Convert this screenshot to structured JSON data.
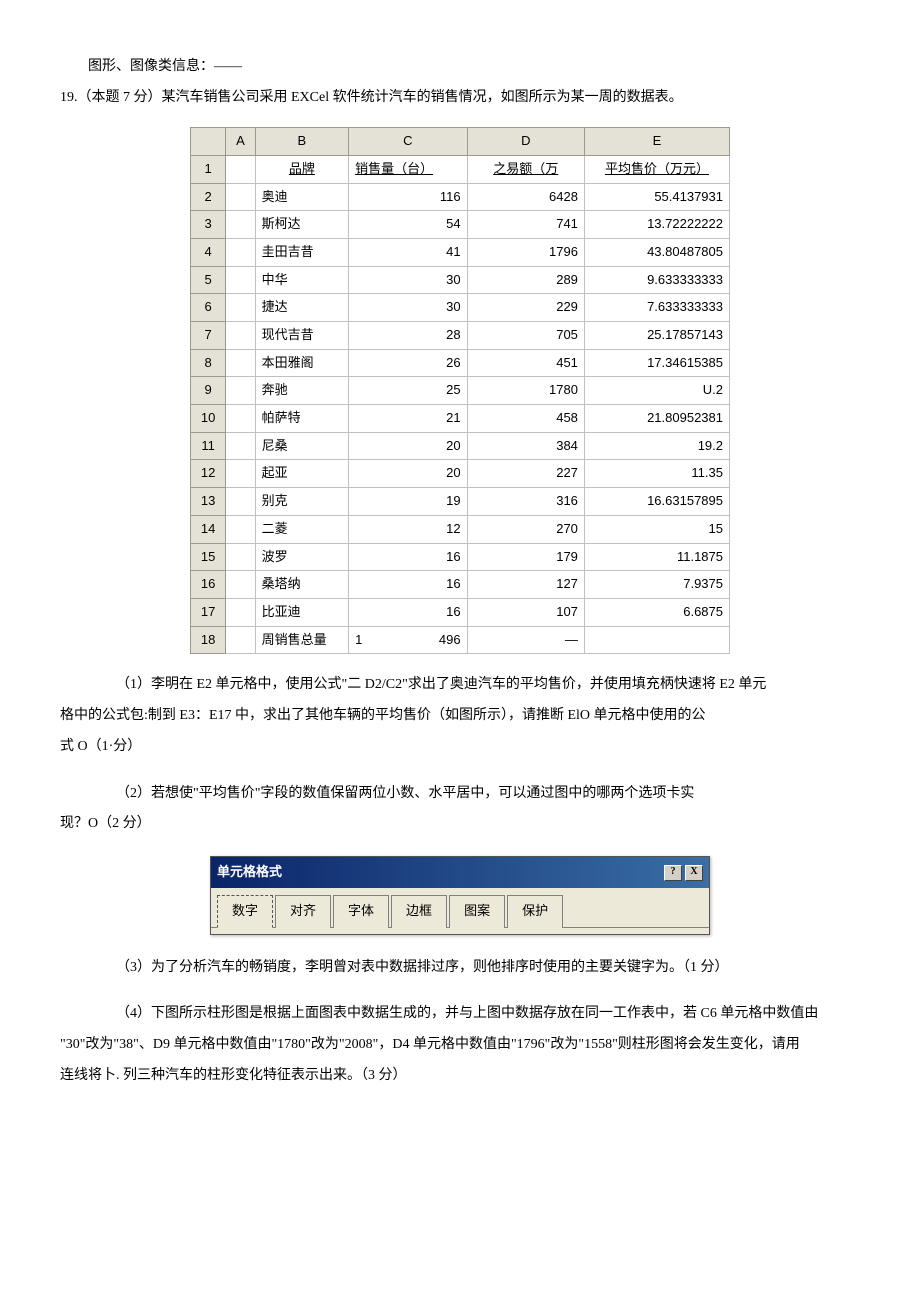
{
  "intro1": "图形、图像类信息：——",
  "intro2": "19.（本题 7 分）某汽车销售公司采用 EXCel 软件统计汽车的销售情况，如图所示为某一周的数据表。",
  "excel": {
    "col_headers": {
      "rownum": "",
      "A": "A",
      "B": "B",
      "C": "C",
      "D": "D",
      "E": "E"
    },
    "header_row": {
      "num": "1",
      "brand": "品牌",
      "sales": "销售量（台）",
      "amount": "之易额（万",
      "avg": "平均售价（万元）"
    },
    "rows": [
      {
        "num": "2",
        "brand": "奥迪",
        "sales": "116",
        "amount": "6428",
        "avg": "55.4137931"
      },
      {
        "num": "3",
        "brand": "斯柯达",
        "sales": "54",
        "amount": "741",
        "avg": "13.72222222"
      },
      {
        "num": "4",
        "brand": "圭田吉昔",
        "sales": "41",
        "amount": "1796",
        "avg": "43.80487805"
      },
      {
        "num": "5",
        "brand": "中华",
        "sales": "30",
        "amount": "289",
        "avg": "9.633333333"
      },
      {
        "num": "6",
        "brand": "捷达",
        "sales": "30",
        "amount": "229",
        "avg": "7.633333333"
      },
      {
        "num": "7",
        "brand": "现代吉昔",
        "sales": "28",
        "amount": "705",
        "avg": "25.17857143"
      },
      {
        "num": "8",
        "brand": "本田雅阁",
        "sales": "26",
        "amount": "451",
        "avg": "17.34615385"
      },
      {
        "num": "9",
        "brand": "奔驰",
        "sales": "25",
        "amount": "1780",
        "avg": "U.2"
      },
      {
        "num": "10",
        "brand": "帕萨特",
        "sales": "21",
        "amount": "458",
        "avg": "21.80952381"
      },
      {
        "num": "11",
        "brand": "尼桑",
        "sales": "20",
        "amount": "384",
        "avg": "19.2"
      },
      {
        "num": "12",
        "brand": "起亚",
        "sales": "20",
        "amount": "227",
        "avg": "11.35"
      },
      {
        "num": "13",
        "brand": "别克",
        "sales": "19",
        "amount": "316",
        "avg": "16.63157895"
      },
      {
        "num": "14",
        "brand": "二菱",
        "sales": "12",
        "amount": "270",
        "avg": "15"
      },
      {
        "num": "15",
        "brand": "波罗",
        "sales": "16",
        "amount": "179",
        "avg": "11.1875"
      },
      {
        "num": "16",
        "brand": "桑塔纳",
        "sales": "16",
        "amount": "127",
        "avg": "7.9375"
      },
      {
        "num": "17",
        "brand": "比亚迪",
        "sales": "16",
        "amount": "107",
        "avg": "6.6875"
      }
    ],
    "total_row": {
      "num": "18",
      "brand": "周销售总量",
      "sales_prefix": "1",
      "sales": "496",
      "amount": "—",
      "avg": ""
    }
  },
  "q1a": "（1）李明在 E2 单元格中，使用公式\"二 D2/C2\"求出了奥迪汽车的平均售价，并使用填充柄快速将 E2 单元",
  "q1b": "格中的公式包:制到 E3：E17 中，求出了其他车辆的平均售价（如图所示），请推断 ElO 单元格中使用的公",
  "q1c": "式 O（1·分）",
  "q2a": "（2）若想使\"平均售价\"字段的数值保留两位小数、水平居中，可以通过图中的哪两个选项卡实",
  "q2b": "现？O（2 分）",
  "dialog": {
    "title": "单元格格式",
    "help": "?",
    "close": "X",
    "tabs": [
      "数字",
      "对齐",
      "字体",
      "边框",
      "图案",
      "保护"
    ]
  },
  "q3": "（3）为了分析汽车的畅销度，李明曾对表中数据排过序，则他排序时使用的主要关键字为。（1 分）",
  "q4a": "（4）下图所示柱形图是根据上面图表中数据生成的，并与上图中数据存放在同一工作表中，若 C6 单元格中数值由",
  "q4b": "\"30\"改为\"38\"、D9 单元格中数值由\"1780\"改为\"2008\"，D4 单元格中数值由\"1796\"改为\"1558\"则柱形图将会发生变化，请用",
  "q4c": "连线将卜. 列三种汽车的柱形变化特征表示出来。（3 分）"
}
